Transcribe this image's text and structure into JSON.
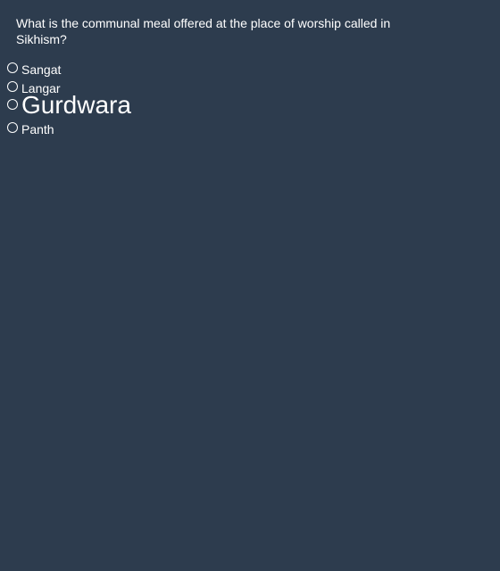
{
  "quiz": {
    "question": "What is the communal meal offered at the place of worship called in Sikhism?",
    "options": [
      {
        "label": "Sangat",
        "selected": false
      },
      {
        "label": "Langar",
        "selected": false
      },
      {
        "label": "Gurdwara",
        "selected": false
      },
      {
        "label": "Panth",
        "selected": false
      }
    ]
  },
  "colors": {
    "background": "#2d3c4e",
    "text": "#ffffff"
  }
}
